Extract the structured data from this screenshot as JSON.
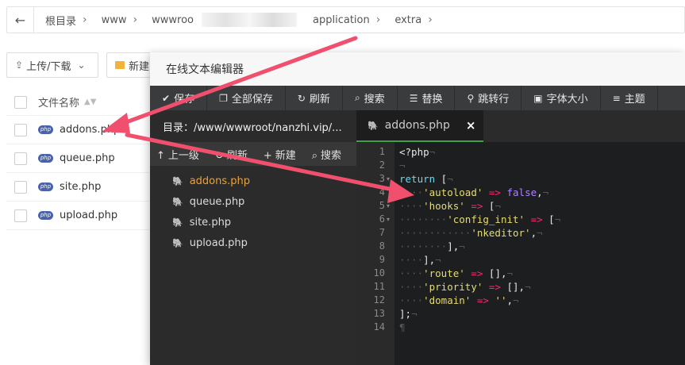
{
  "breadcrumb": {
    "items": [
      "根目录",
      "www",
      "wwwroo",
      "application",
      "extra"
    ]
  },
  "toolbar": {
    "upload_label": "上传/下载",
    "new_label": "新建"
  },
  "file_list": {
    "header": "文件名称",
    "files": [
      "addons.php",
      "queue.php",
      "site.php",
      "upload.php"
    ]
  },
  "editor": {
    "title": "在线文本编辑器",
    "toolbar": [
      {
        "icon": "check-icon",
        "glyph": "✔",
        "label": "保存"
      },
      {
        "icon": "copy-icon",
        "glyph": "❐",
        "label": "全部保存"
      },
      {
        "icon": "refresh-icon",
        "glyph": "↻",
        "label": "刷新"
      },
      {
        "icon": "search-icon",
        "glyph": "⌕",
        "label": "搜索"
      },
      {
        "icon": "replace-icon",
        "glyph": "☰",
        "label": "替换"
      },
      {
        "icon": "goto-line-icon",
        "glyph": "⚲",
        "label": "跳转行"
      },
      {
        "icon": "font-size-icon",
        "glyph": "▣",
        "label": "字体大小"
      },
      {
        "icon": "theme-icon",
        "glyph": "≡",
        "label": "主题"
      }
    ],
    "sidebar": {
      "path": "目录：/www/wwwroot/nanzhi.vip/...",
      "actions": [
        {
          "icon": "up-level-icon",
          "glyph": "↑",
          "label": "上一级"
        },
        {
          "icon": "refresh-icon",
          "glyph": "↻",
          "label": "刷新"
        },
        {
          "icon": "plus-icon",
          "glyph": "+",
          "label": "新建"
        },
        {
          "icon": "search-icon",
          "glyph": "⌕",
          "label": "搜索"
        }
      ],
      "files": [
        "addons.php",
        "queue.php",
        "site.php",
        "upload.php"
      ],
      "active_file": "addons.php"
    },
    "tab": {
      "label": "addons.php",
      "close": "×"
    },
    "code_lines": [
      "<?php",
      "",
      "return [",
      "    'autoload' => false,",
      "    'hooks' => [",
      "        'config_init' => [",
      "            'nkeditor',",
      "        ],",
      "    ],",
      "    'route' => [],",
      "    'priority' => [],",
      "    'domain' => '',",
      "];",
      ""
    ],
    "line_numbers": [
      "1",
      "2",
      "3",
      "4",
      "5",
      "6",
      "7",
      "8",
      "9",
      "10",
      "11",
      "12",
      "13",
      "14"
    ],
    "fold_lines": [
      3,
      5,
      6
    ]
  },
  "colors": {
    "arrow": "#f0506e",
    "tab_accent": "#3fa04a",
    "active_file": "#f0a030"
  }
}
